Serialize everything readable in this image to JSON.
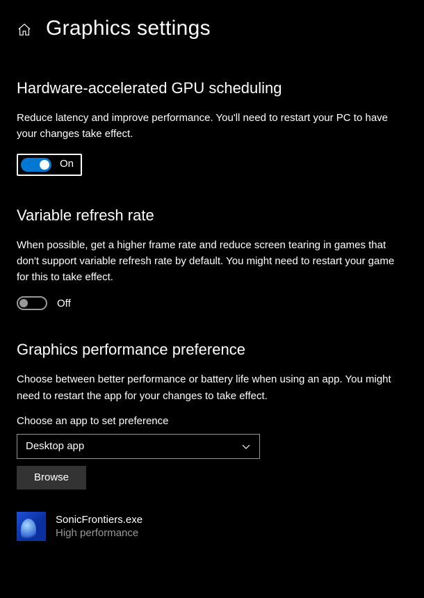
{
  "header": {
    "title": "Graphics settings"
  },
  "sections": {
    "gpu_scheduling": {
      "title": "Hardware-accelerated GPU scheduling",
      "description": "Reduce latency and improve performance. You'll need to restart your PC to have your changes take effect.",
      "toggle_state": "On",
      "toggle_on": true
    },
    "vrr": {
      "title": "Variable refresh rate",
      "description": "When possible, get a higher frame rate and reduce screen tearing in games that don't support variable refresh rate by default. You might need to restart your game for this to take effect.",
      "toggle_state": "Off",
      "toggle_on": false
    },
    "perf_pref": {
      "title": "Graphics performance preference",
      "description": "Choose between better performance or battery life when using an app. You might need to restart the app for your changes to take effect.",
      "choose_label": "Choose an app to set preference",
      "selected_option": "Desktop app",
      "browse_label": "Browse"
    }
  },
  "app_list": [
    {
      "name": "SonicFrontiers.exe",
      "preference": "High performance"
    }
  ]
}
